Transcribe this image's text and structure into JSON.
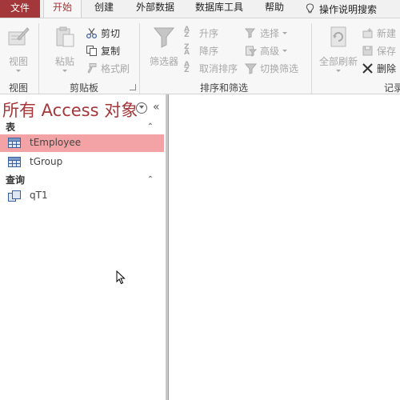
{
  "tabs": {
    "file": "文件",
    "items": [
      "开始",
      "创建",
      "外部数据",
      "数据库工具",
      "帮助"
    ],
    "tell_me": "操作说明搜索"
  },
  "ribbon": {
    "views": {
      "view_label": "视图",
      "group_label": "视图"
    },
    "clipboard": {
      "paste_label": "粘贴",
      "cut_label": "剪切",
      "copy_label": "复制",
      "format_painter_label": "格式刷",
      "group_label": "剪贴板"
    },
    "sort_filter": {
      "filter_label": "筛选器",
      "ascending_label": "升序",
      "descending_label": "降序",
      "remove_sort_label": "取消排序",
      "selection_label": "选择",
      "advanced_label": "高级",
      "toggle_filter_label": "切换筛选",
      "group_label": "排序和筛选"
    },
    "records": {
      "refresh_all_label": "全部刷新",
      "new_label": "新建",
      "save_label": "保存",
      "delete_label": "删除",
      "group_label": "记录"
    }
  },
  "nav": {
    "title": "所有 Access 对象",
    "sections": [
      {
        "label": "表",
        "items": [
          {
            "label": "tEmployee",
            "selected": true
          },
          {
            "label": "tGroup",
            "selected": false
          }
        ]
      },
      {
        "label": "查询",
        "items": [
          {
            "label": "qT1",
            "selected": false
          }
        ]
      }
    ]
  },
  "colors": {
    "accent": "#a4373a",
    "selection": "#f3a3a5",
    "icon_blue": "#3a5fa0"
  }
}
